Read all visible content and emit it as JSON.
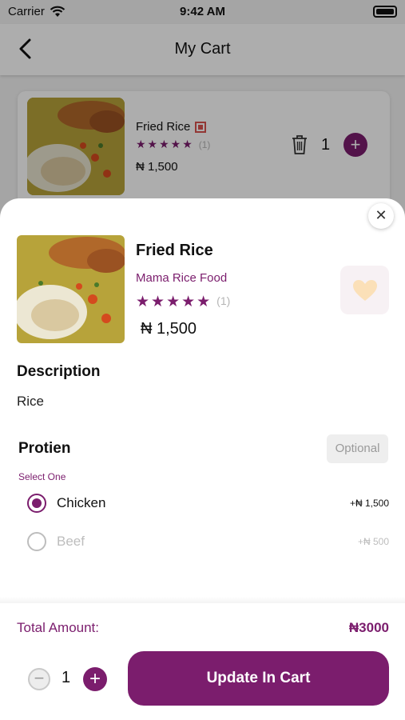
{
  "status_bar": {
    "carrier": "Carrier",
    "time": "9:42 AM"
  },
  "nav": {
    "title": "My Cart"
  },
  "cart_item": {
    "name": "Fried Rice",
    "stars": "★★★★★",
    "rating_count": "(1)",
    "price": "₦ 1,500",
    "quantity": "1",
    "plus": "+"
  },
  "sheet": {
    "close": "✕",
    "product": {
      "name": "Fried Rice",
      "vendor": "Mama Rice Food",
      "stars": "★★★★★",
      "rating_value": 5,
      "rating_count": "(1)",
      "price": "₦ 1,500"
    },
    "description": {
      "title": "Description",
      "text": "Rice"
    },
    "protein": {
      "title": "Protien",
      "badge": "Optional",
      "hint": "Select One",
      "options": [
        {
          "label": "Chicken",
          "price": "+₦ 1,500",
          "selected": true
        },
        {
          "label": "Beef",
          "price": "+₦ 500",
          "selected": false
        }
      ]
    },
    "footer": {
      "total_label": "Total Amount:",
      "total_value": "₦3000",
      "minus": "−",
      "quantity": "1",
      "plus": "+",
      "update_label": "Update In Cart"
    }
  },
  "colors": {
    "accent": "#7b1d6d",
    "heart": "#fbe0b8",
    "veg_mark": "#d9534f"
  },
  "icons": [
    "wifi-icon",
    "battery-icon",
    "back-chevron-icon",
    "trash-icon",
    "plus-icon",
    "close-icon",
    "heart-icon",
    "minus-icon"
  ]
}
